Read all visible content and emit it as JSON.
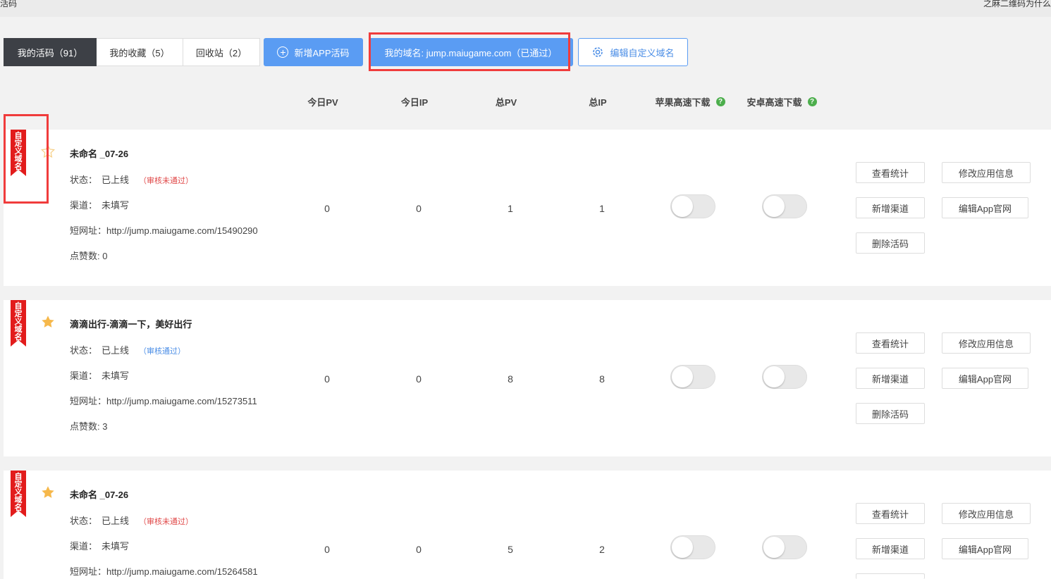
{
  "topbar": {
    "left_text": "活码",
    "right_text": "之麻二维码为什么"
  },
  "tabs": [
    {
      "label": "我的活码（91）"
    },
    {
      "label": "我的收藏（5）"
    },
    {
      "label": "回收站（2）"
    }
  ],
  "actions": {
    "add_app_label": "新增APP活码",
    "domain_label": "我的域名: jump.maiugame.com（已通过）",
    "edit_domain_label": "编辑自定义域名"
  },
  "columns": {
    "today_pv": "今日PV",
    "today_ip": "今日IP",
    "total_pv": "总PV",
    "total_ip": "总IP",
    "ios_download": "苹果高速下载",
    "android_download": "安卓高速下载",
    "help_glyph": "?"
  },
  "labels": {
    "ribbon": [
      "自",
      "定",
      "义",
      "域",
      "名"
    ],
    "status": "状态：",
    "channel": "渠道：",
    "short_url": "短网址：",
    "likes": "点赞数: "
  },
  "buttons": {
    "view_stats": "查看统计",
    "edit_app_info": "修改应用信息",
    "add_channel": "新增渠道",
    "edit_app_site": "编辑App官网",
    "delete_code": "删除活码"
  },
  "codes": [
    {
      "name": "未命名 _07-26",
      "starred": false,
      "status": "已上线",
      "audit": "（审核未通过）",
      "channel": "未填写",
      "url": "http://jump.maiugame.com/15490290",
      "likes": "0",
      "today_pv": "0",
      "today_ip": "0",
      "total_pv": "1",
      "total_ip": "1"
    },
    {
      "name": "滴滴出行-滴滴一下，美好出行",
      "starred": true,
      "status": "已上线",
      "audit": "（审核通过）",
      "channel": "未填写",
      "url": "http://jump.maiugame.com/15273511",
      "likes": "3",
      "today_pv": "0",
      "today_ip": "0",
      "total_pv": "8",
      "total_ip": "8"
    },
    {
      "name": "未命名 _07-26",
      "starred": true,
      "status": "已上线",
      "audit": "（审核未通过）",
      "channel": "未填写",
      "url": "http://jump.maiugame.com/15264581",
      "likes": "",
      "today_pv": "0",
      "today_ip": "0",
      "total_pv": "5",
      "total_ip": "2"
    }
  ],
  "colors": {
    "accent": "#5a9cf3",
    "dark_tab": "#3d4046",
    "ribbon": "#e21c1c",
    "highlight": "#f03c3c",
    "star": "#f6b84b"
  }
}
